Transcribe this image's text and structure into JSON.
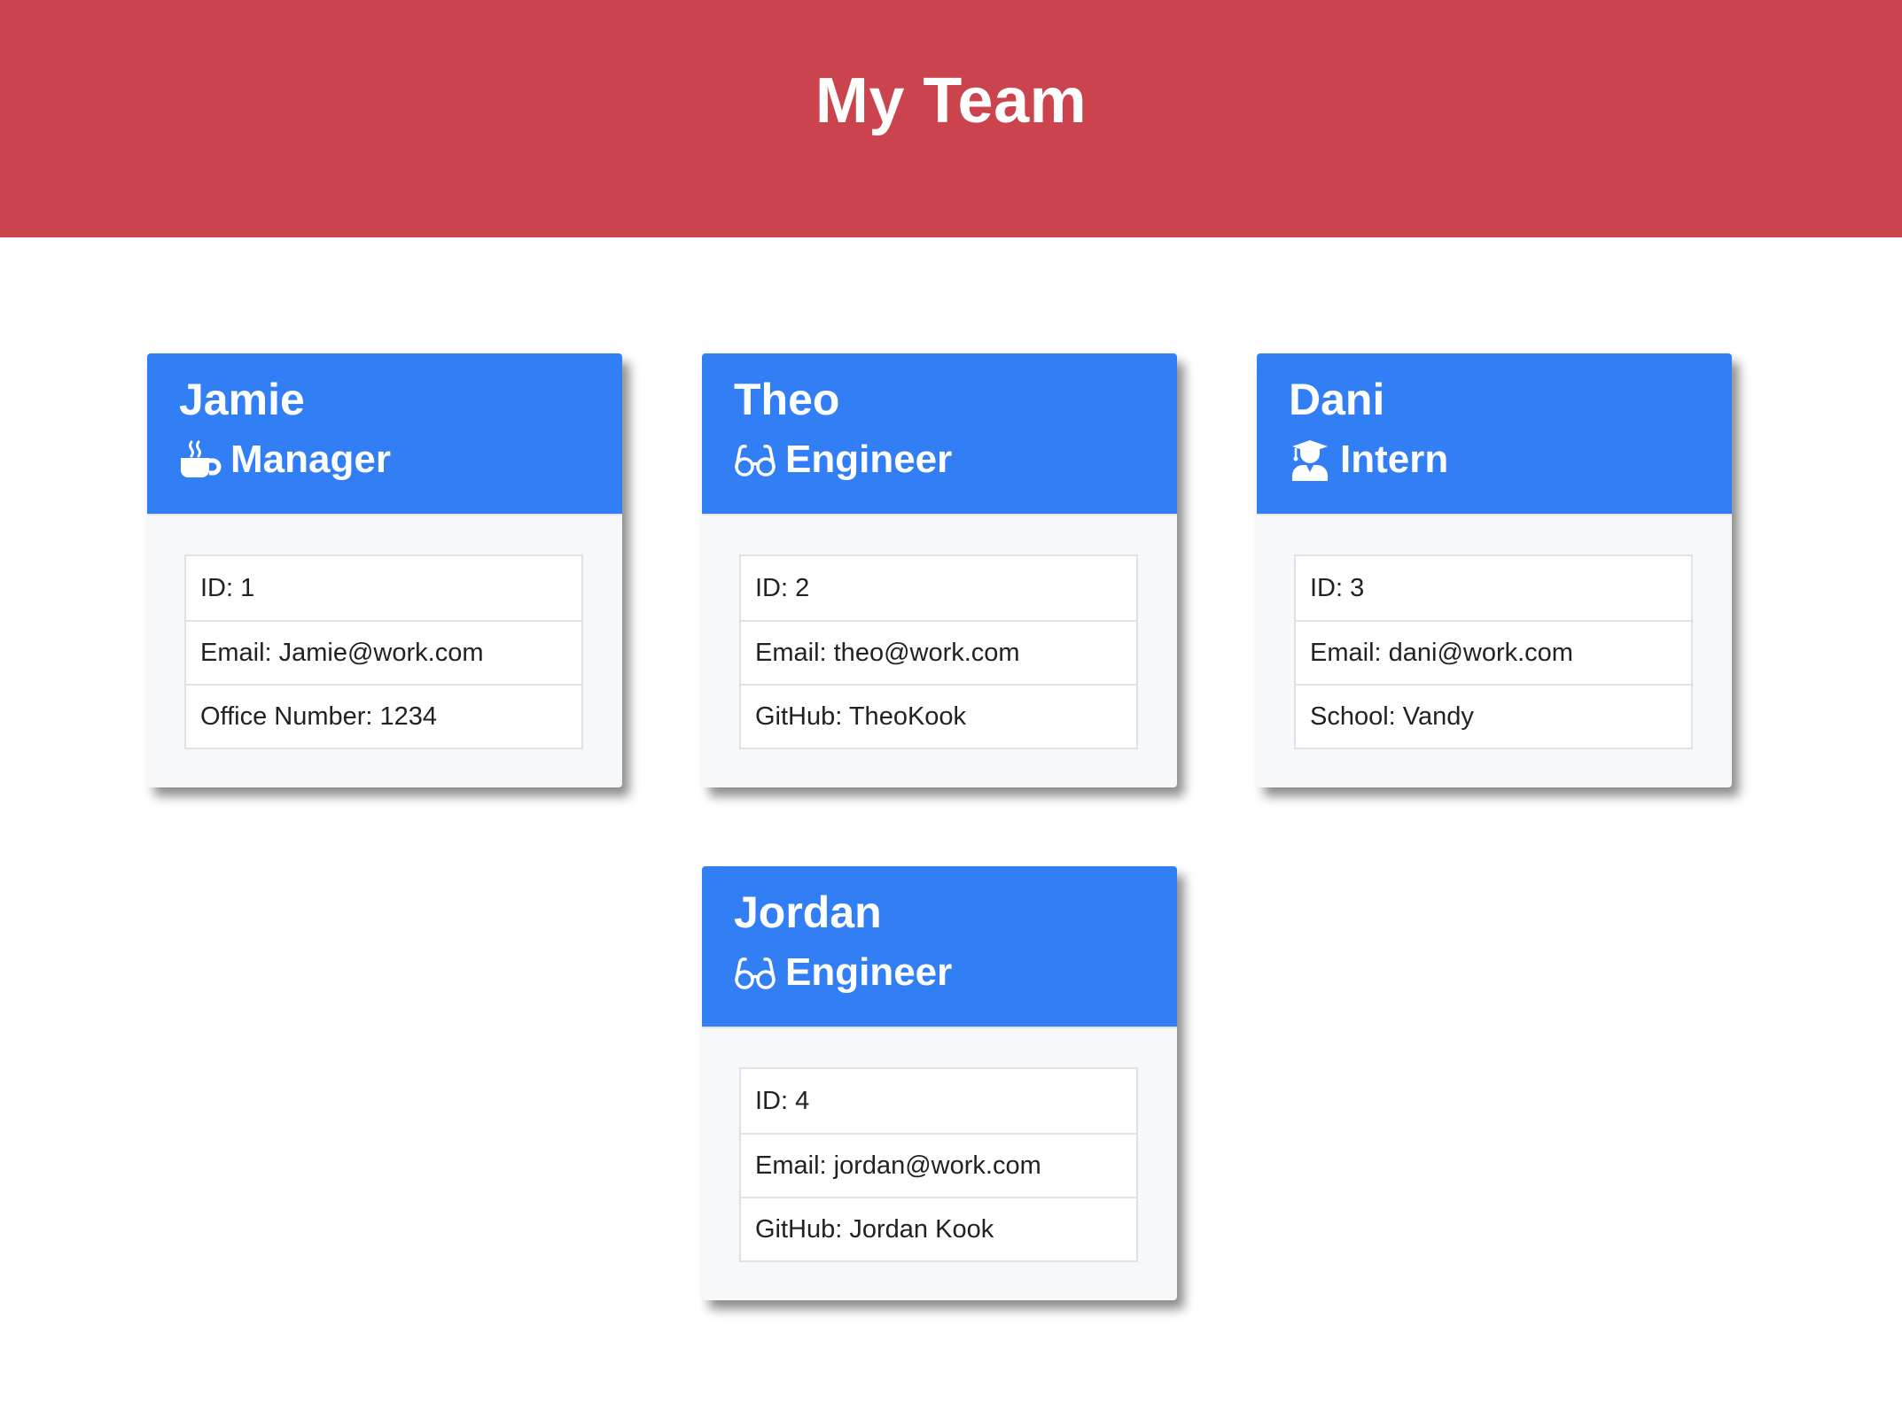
{
  "header": {
    "title": "My Team"
  },
  "colors": {
    "header_bg": "#cb434c",
    "card_header_bg": "#327ff5"
  },
  "team": [
    {
      "name": "Jamie",
      "role": "Manager",
      "icon": "coffee-mug-icon",
      "details": [
        "ID: 1",
        "Email: Jamie@work.com",
        "Office Number: 1234"
      ]
    },
    {
      "name": "Theo",
      "role": "Engineer",
      "icon": "glasses-icon",
      "details": [
        "ID: 2",
        "Email: theo@work.com",
        "GitHub: TheoKook"
      ]
    },
    {
      "name": "Dani",
      "role": "Intern",
      "icon": "graduate-icon",
      "details": [
        "ID: 3",
        "Email: dani@work.com",
        "School: Vandy"
      ]
    },
    {
      "name": "Jordan",
      "role": "Engineer",
      "icon": "glasses-icon",
      "details": [
        "ID: 4",
        "Email: jordan@work.com",
        "GitHub: Jordan Kook"
      ]
    }
  ]
}
